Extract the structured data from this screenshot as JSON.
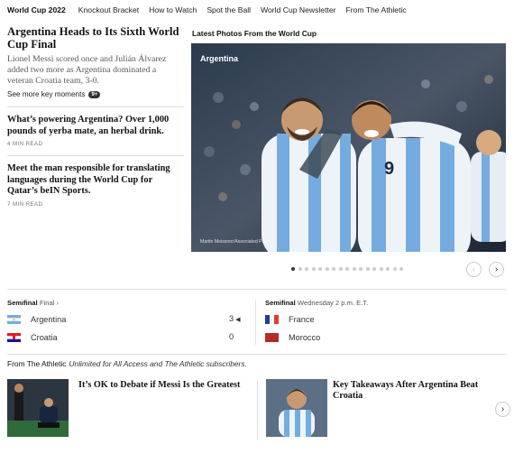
{
  "nav": {
    "brand": "World Cup 2022",
    "links": [
      "Knockout Bracket",
      "How to Watch",
      "Spot the Ball",
      "World Cup Newsletter",
      "From The Athletic"
    ]
  },
  "lead": {
    "title": "Argentina Heads to Its Sixth World Cup Final",
    "summary": "Lionel Messi scored once and Julián Álvarez added two more as Argentina dominated a veteran Croatia team, 3-0.",
    "key_moments_label": "See more key moments",
    "key_moments_badge": "9+"
  },
  "stories": [
    {
      "title": "What’s powering Argentina? Over 1,000 pounds of yerba mate, an herbal drink.",
      "readtime": "4 MIN READ"
    },
    {
      "title": "Meet the man responsible for translating languages during the World Cup for Qatar’s beIN Sports.",
      "readtime": "7 MIN READ"
    }
  ],
  "photos": {
    "heading": "Latest Photos From the World Cup",
    "tag": "Argentina",
    "credit": "Martin Meissner/Associated Press",
    "dot_count": 17,
    "active_dot": 0,
    "prev_icon": "chevron-left-icon",
    "next_icon": "chevron-right-icon"
  },
  "scoreboard": {
    "left": {
      "stage": "Semifinal",
      "detail": "Final",
      "teams": [
        {
          "name": "Argentina",
          "score": "3",
          "winner": true,
          "flag": "argentina"
        },
        {
          "name": "Croatia",
          "score": "0",
          "winner": false,
          "flag": "croatia"
        }
      ]
    },
    "right": {
      "stage": "Semifinal",
      "detail": "Wednesday 2 p.m. E.T.",
      "teams": [
        {
          "name": "France",
          "flag": "france"
        },
        {
          "name": "Morocco",
          "flag": "morocco"
        }
      ]
    }
  },
  "athletic": {
    "label": "From The Athletic",
    "subtitle": "Unlimited for All Access and The Athletic subscribers.",
    "cards": [
      {
        "title": "It’s OK to Debate if Messi Is the Greatest"
      },
      {
        "title": "Key Takeaways After Argentina Beat Croatia"
      }
    ],
    "next_icon": "chevron-right-icon"
  },
  "colors": {
    "argentina_blue": "#74acdf",
    "croatia_red": "#e21b23",
    "france_blue": "#1f3c99",
    "france_red": "#e53935",
    "morocco_red": "#b52b27",
    "pitch_green": "#2f6b3a"
  }
}
